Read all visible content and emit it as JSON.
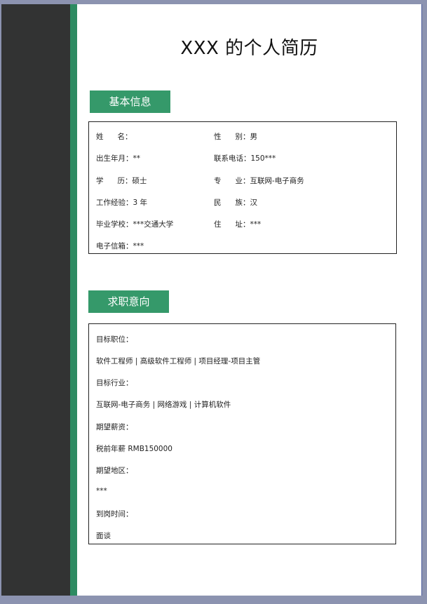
{
  "title": "XXX 的个人简历",
  "colors": {
    "sidebar_dark": "#323333",
    "sidebar_green": "#2e8b62",
    "heading_bg": "#35996a"
  },
  "basic_info": {
    "heading": "基本信息",
    "rows": [
      {
        "left_label_a": "姓",
        "left_label_b": "名",
        "left_value": "",
        "right_label_a": "性",
        "right_label_b": "别",
        "right_value": "男"
      },
      {
        "left_label": "出生年月",
        "left_value": "**",
        "right_label": "联系电话",
        "right_value": "150***"
      },
      {
        "left_label_a": "学",
        "left_label_b": "历",
        "left_value": "硕士",
        "right_label_a": "专",
        "right_label_b": "业",
        "right_value": "互联网-电子商务"
      },
      {
        "left_label": "工作经验",
        "left_value": "3 年",
        "right_label_a": "民",
        "right_label_b": "族",
        "right_value": "汉"
      },
      {
        "left_label": "毕业学校",
        "left_value": "***交通大学",
        "right_label_a": "住",
        "right_label_b": "址",
        "right_value": "***"
      },
      {
        "left_label": "电子信箱",
        "left_value": "***"
      }
    ]
  },
  "job_intent": {
    "heading": "求职意向",
    "lines": [
      "目标职位：",
      "软件工程师 | 高级软件工程师 | 项目经理-项目主管",
      "目标行业：",
      "互联网-电子商务 | 网络游戏 | 计算机软件",
      "期望薪资：",
      "税前年薪 RMB150000",
      "期望地区：",
      "***",
      "到岗时间：",
      "面谈"
    ]
  },
  "sep": "："
}
